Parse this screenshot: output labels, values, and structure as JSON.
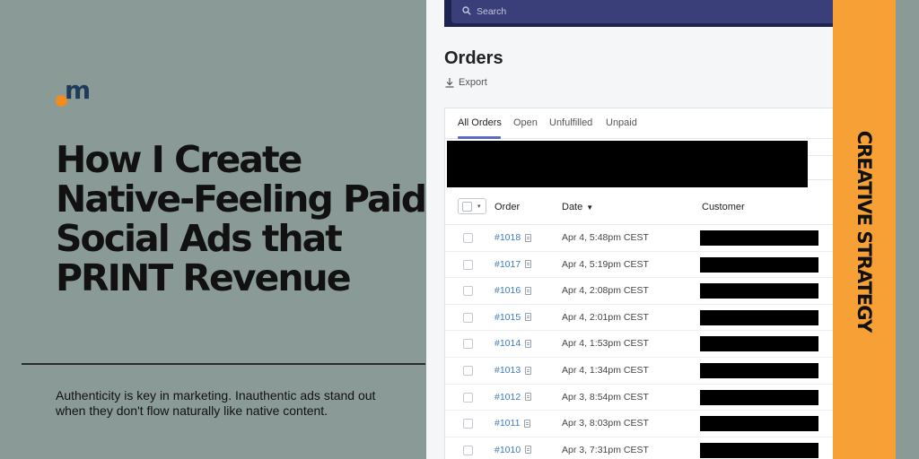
{
  "brand": {
    "logo_letter": "m",
    "accent": "#f28c1e",
    "logo_color": "#1f3a5a"
  },
  "headline": [
    "How I Create",
    "Native-Feeling Paid",
    "Social Ads that",
    "PRINT Revenue"
  ],
  "subtext": "Authenticity is key in marketing. Inauthentic ads stand out when they don't flow naturally like native content.",
  "sidebar_label": "CREATIVE STRATEGY",
  "admin": {
    "search_placeholder": "Search",
    "page_title": "Orders",
    "export_label": "Export",
    "tabs": [
      "All Orders",
      "Open",
      "Unfulfilled",
      "Unpaid"
    ],
    "active_tab": "All Orders",
    "columns": {
      "order": "Order",
      "date": "Date",
      "customer": "Customer"
    },
    "orders": [
      {
        "id": "#1018",
        "date": "Apr 4, 5:48pm CEST"
      },
      {
        "id": "#1017",
        "date": "Apr 4, 5:19pm CEST"
      },
      {
        "id": "#1016",
        "date": "Apr 4, 2:08pm CEST"
      },
      {
        "id": "#1015",
        "date": "Apr 4, 2:01pm CEST"
      },
      {
        "id": "#1014",
        "date": "Apr 4, 1:53pm CEST"
      },
      {
        "id": "#1013",
        "date": "Apr 4, 1:34pm CEST"
      },
      {
        "id": "#1012",
        "date": "Apr 3, 8:54pm CEST"
      },
      {
        "id": "#1011",
        "date": "Apr 3, 8:03pm CEST"
      },
      {
        "id": "#1010",
        "date": "Apr 3, 7:31pm CEST"
      }
    ]
  },
  "colors": {
    "background": "#8a9a97",
    "band": "#f7a036",
    "topbar": "#1e2352",
    "tab_underline": "#5c6ac4",
    "link": "#3b7bbf"
  }
}
